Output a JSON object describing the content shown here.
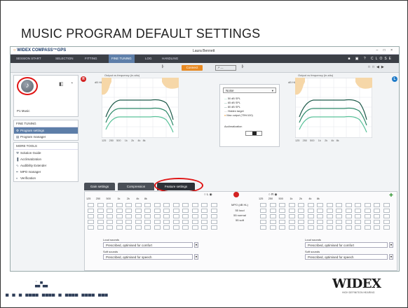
{
  "slide": {
    "title": "MUSIC PROGRAM DEFAULT SETTINGS"
  },
  "app": {
    "logo_prefix": "WIDEX",
    "logo_suffix": "COMPASS™GPS",
    "patient_name": "Laura Bennett",
    "window_controls": "– □ ×"
  },
  "nav": {
    "tabs": [
      "SESSION START",
      "SELECTION",
      "FITTING",
      "FINE TUNING",
      "LOG",
      "HANDLING"
    ],
    "active_index": 3,
    "right_label": "CLOSE"
  },
  "toolbar": {
    "connect_label": "Connect"
  },
  "sidebar": {
    "program_name": "P1 Music",
    "fine_tuning": {
      "header": "FINE TUNING",
      "items": [
        {
          "label": "Program settings",
          "selected": true
        },
        {
          "label": "Program manager",
          "selected": false
        }
      ]
    },
    "more_tools": {
      "header": "MORE TOOLS",
      "items": [
        {
          "label": "Solution Guide"
        },
        {
          "label": "Acclimatization"
        },
        {
          "label": "Audibility Extender"
        },
        {
          "label": "MPO manager"
        },
        {
          "label": "Verification"
        }
      ]
    }
  },
  "graphs": {
    "left_title": "Output vs frequency (in-situ)",
    "right_title": "Output vs frequency (in-situ)",
    "y_label": "dB HL",
    "x_ticks": [
      "125",
      "250",
      "500",
      "1k",
      "2k",
      "4k",
      "8k"
    ]
  },
  "mid_panel": {
    "select_value": "Noise",
    "legend": [
      "50 dB SPL",
      "65 dB SPL",
      "80 dB SPL",
      "Hidden target",
      "Max output (75%/100)"
    ],
    "acclimatization_label": "Acclimatization"
  },
  "bottom_tabs": [
    {
      "label": "Gain settings",
      "active": false
    },
    {
      "label": "Compression",
      "active": false
    },
    {
      "label": "Feature settings",
      "active": true
    }
  ],
  "gain_grid": {
    "freq_labels": [
      "125",
      "250",
      "500",
      "1k",
      "2k",
      "4k",
      "8k"
    ],
    "mid_labels": [
      "MPO (dB HL)",
      "55 loud",
      "55 normal",
      "55 soft"
    ],
    "left_ear_label": "L",
    "right_ear_label": "R"
  },
  "feature_dropdowns": {
    "left": [
      {
        "label": "Loud sounds",
        "value": "Prescribed, optimised for comfort"
      },
      {
        "label": "Soft sounds",
        "value": "Prescribed, optimised for speech"
      }
    ],
    "right": [
      {
        "label": "Loud sounds",
        "value": "Prescribed, optimised for comfort"
      },
      {
        "label": "Soft sounds",
        "value": "Prescribed, optimised for speech"
      }
    ]
  },
  "brand": {
    "name": "WIDEX",
    "tagline": "HIGH DEFINITION HEARING"
  },
  "colors": {
    "accent": "#e88a22",
    "highlight": "#e01414",
    "selected": "#5d7ea8",
    "nav": "#3b3f46"
  }
}
